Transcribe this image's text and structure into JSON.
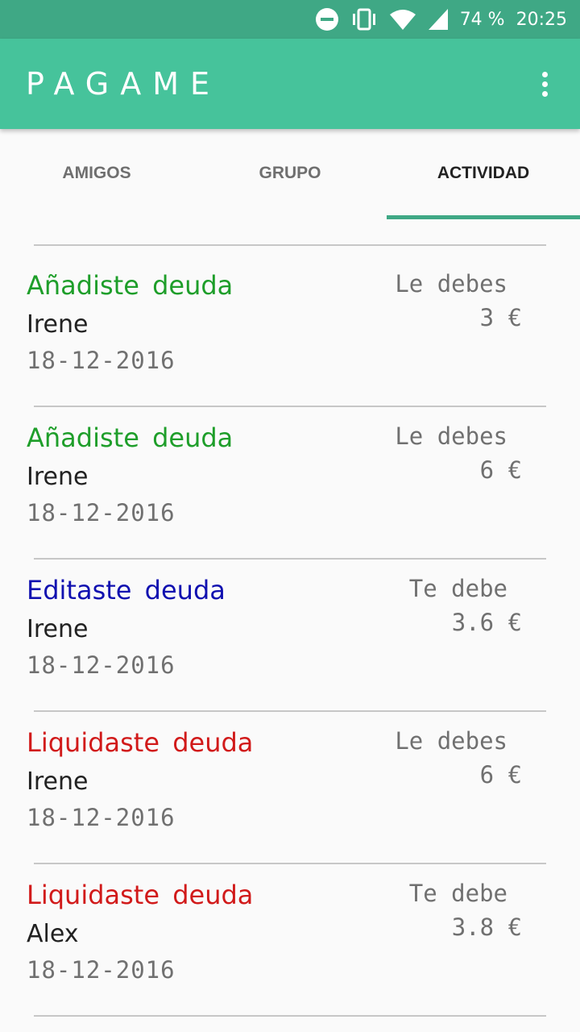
{
  "status_bar": {
    "battery": "74 %",
    "time": "20:25",
    "icons": [
      "do-not-disturb-icon",
      "vibrate-icon",
      "wifi-icon",
      "signal-icon"
    ]
  },
  "app_bar": {
    "title": "PAGAME",
    "menu_icon": "more-vert-icon"
  },
  "tabs": [
    {
      "label": "AMIGOS",
      "active": false
    },
    {
      "label": "GRUPO",
      "active": false
    },
    {
      "label": "ACTIVIDAD",
      "active": true
    }
  ],
  "colors": {
    "status_bar": "#3fa885",
    "app_bar": "#46c39b",
    "added": "#1e9e2a",
    "edited": "#1010b0",
    "settled": "#d11a1a",
    "secondary_text": "#707070"
  },
  "activity": {
    "partial_date": "18-12-2016",
    "items": [
      {
        "action": "Añadiste deuda",
        "action_type": "added",
        "person": "Irene",
        "date": "18-12-2016",
        "relation": "Le debes",
        "amount": "3 €"
      },
      {
        "action": "Añadiste deuda",
        "action_type": "added",
        "person": "Irene",
        "date": "18-12-2016",
        "relation": "Le debes",
        "amount": "6 €"
      },
      {
        "action": "Editaste deuda",
        "action_type": "edited",
        "person": "Irene",
        "date": "18-12-2016",
        "relation": "Te debe",
        "amount": "3.6 €"
      },
      {
        "action": "Liquidaste deuda",
        "action_type": "settled",
        "person": "Irene",
        "date": "18-12-2016",
        "relation": "Le debes",
        "amount": "6 €"
      },
      {
        "action": "Liquidaste deuda",
        "action_type": "settled",
        "person": "Alex",
        "date": "18-12-2016",
        "relation": "Te debe",
        "amount": "3.8 €"
      }
    ]
  }
}
